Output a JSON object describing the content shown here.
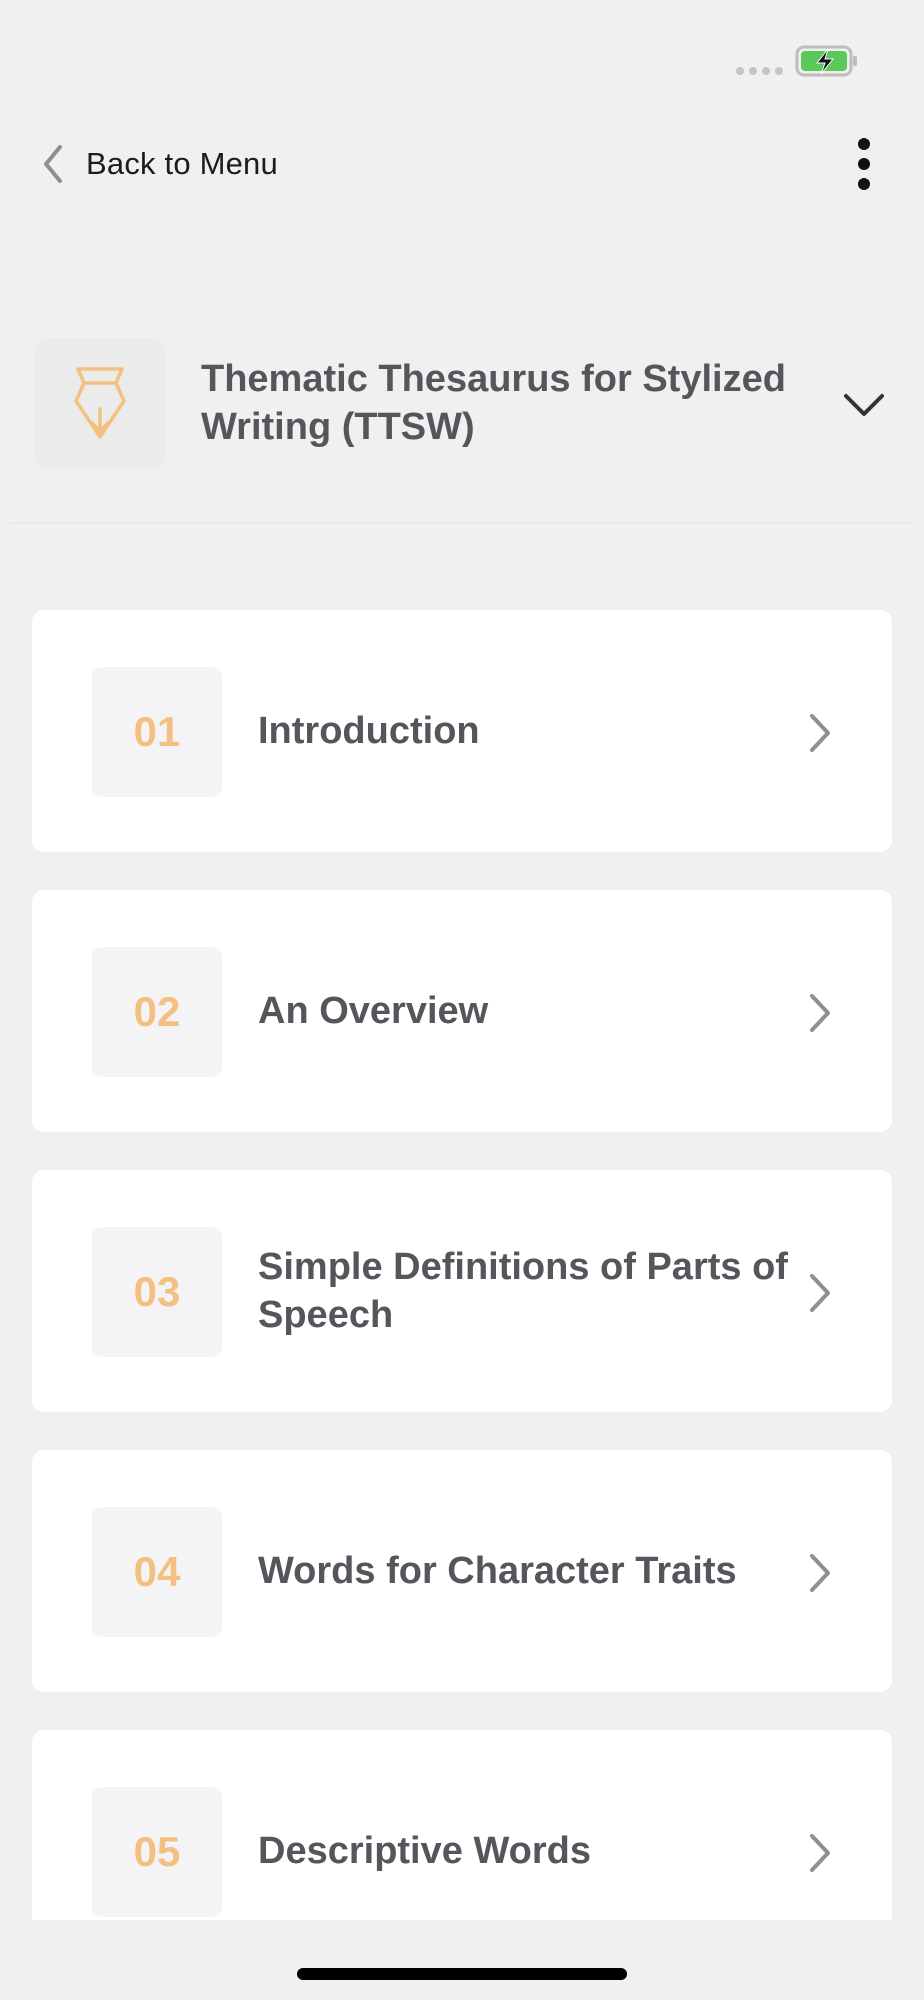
{
  "nav": {
    "back_label": "Back to Menu"
  },
  "book": {
    "title": "Thematic Thesaurus for Stylized Writing (TTSW)",
    "icon": "pen-nib-icon"
  },
  "chapters": [
    {
      "number": "01",
      "title": "Introduction"
    },
    {
      "number": "02",
      "title": "An Overview"
    },
    {
      "number": "03",
      "title": "Simple Definitions of Parts of Speech"
    },
    {
      "number": "04",
      "title": "Words for Character Traits"
    },
    {
      "number": "05",
      "title": "Descriptive Words"
    }
  ],
  "colors": {
    "accent": "#f4c07f",
    "text": "#55555c",
    "background": "#f0f0f0",
    "battery": "#5ac85a"
  }
}
